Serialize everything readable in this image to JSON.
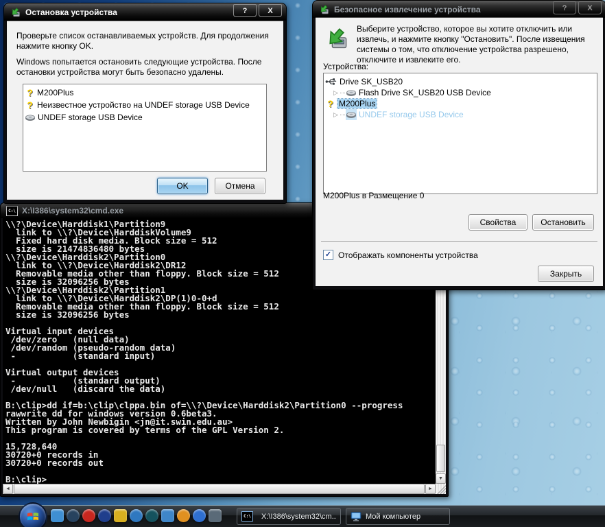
{
  "icons": {
    "help_glyph": "?",
    "close_glyph": "X",
    "question_glyph": "?",
    "expander_glyph": "▷",
    "check_glyph": "✓",
    "scroll_up_glyph": "▲",
    "scroll_down_glyph": "▼",
    "scroll_left_glyph": "◄",
    "scroll_right_glyph": "►",
    "cmd_glyph": "C:\\"
  },
  "stop_dialog": {
    "title": "Остановка устройства",
    "line1": "Проверьте список останавливаемых устройств. Для продолжения нажмите кнопку OK.",
    "line2": "Windows попытается остановить следующие устройства. После остановки устройства могут быть безопасно удалены.",
    "devices": [
      {
        "icon": "question-icon",
        "label": "M200Plus"
      },
      {
        "icon": "question-icon",
        "label": "Неизвестное устройство на UNDEF storage USB Device"
      },
      {
        "icon": "disk-icon",
        "label": "UNDEF storage USB Device"
      }
    ],
    "ok_label": "OK",
    "cancel_label": "Отмена"
  },
  "safe_removal_dialog": {
    "title": "Безопасное извлечение устройства",
    "instruction": "Выберите устройство, которое вы хотите отключить или извлечь, и нажмите кнопку \"Остановить\". После извещения системы о том, что отключение устройства разрешено, отключите и извлеките его.",
    "devices_label": "Устройства:",
    "tree": [
      {
        "icon": "usb-icon",
        "label": "Drive SK_USB20",
        "level": 0
      },
      {
        "icon": "disk-icon",
        "label": "Flash Drive SK_USB20 USB Device",
        "level": 1,
        "expandable": true
      },
      {
        "icon": "question-icon",
        "label": "M200Plus",
        "level": 0,
        "selected": true
      },
      {
        "icon": "disk-icon",
        "label": "UNDEF storage USB Device",
        "level": 1,
        "expandable": true,
        "dimmed": true
      }
    ],
    "status_text": "M200Plus в Размещение 0",
    "properties_label": "Свойства",
    "stop_label": "Остановить",
    "checkbox_label": "Отображать компоненты устройства",
    "checkbox_checked": true,
    "close_label": "Закрыть"
  },
  "cmd_window": {
    "title": "X:\\I386\\system32\\cmd.exe",
    "console_text": "\\\\?\\Device\\Harddisk1\\Partition9\n  link to \\\\?\\Device\\HarddiskVolume9\n  Fixed hard disk media. Block size = 512\n  size is 21474836480 bytes\n\\\\?\\Device\\Harddisk2\\Partition0\n  link to \\\\?\\Device\\Harddisk2\\DR12\n  Removable media other than floppy. Block size = 512\n  size is 32096256 bytes\n\\\\?\\Device\\Harddisk2\\Partition1\n  link to \\\\?\\Device\\Harddisk2\\DP(1)0-0+d\n  Removable media other than floppy. Block size = 512\n  size is 32096256 bytes\n\nVirtual input devices\n /dev/zero   (null data)\n /dev/random (pseudo-random data)\n -           (standard input)\n\nVirtual output devices\n -           (standard output)\n /dev/null   (discard the data)\n\nB:\\clip>dd if=b:\\clip\\clppa.bin of=\\\\?\\Device\\Harddisk2\\Partition0 --progress\nrawwrite dd for windows version 0.6beta3.\nWritten by John Newbigin <jn@it.swin.edu.au>\nThis program is covered by terms of the GPL Version 2.\n\n15,728,640\n30720+0 records in\n30720+0 records out\n\nB:\\clip>"
  },
  "taskbar": {
    "task_buttons": [
      {
        "icon": "cmd-icon",
        "label": "X:\\I386\\system32\\cm..."
      },
      {
        "icon": "my-computer-icon",
        "label": "Мой компьютер"
      }
    ],
    "quick_launch": [
      "app-launcher-icon",
      "media-disc-icon",
      "red-power-icon",
      "blue-power-icon",
      "memory-chip-icon",
      "gear-icon",
      "globe-icon",
      "network-computer-icon",
      "packages-icon",
      "media-play-icon",
      "display-settings-icon"
    ]
  }
}
